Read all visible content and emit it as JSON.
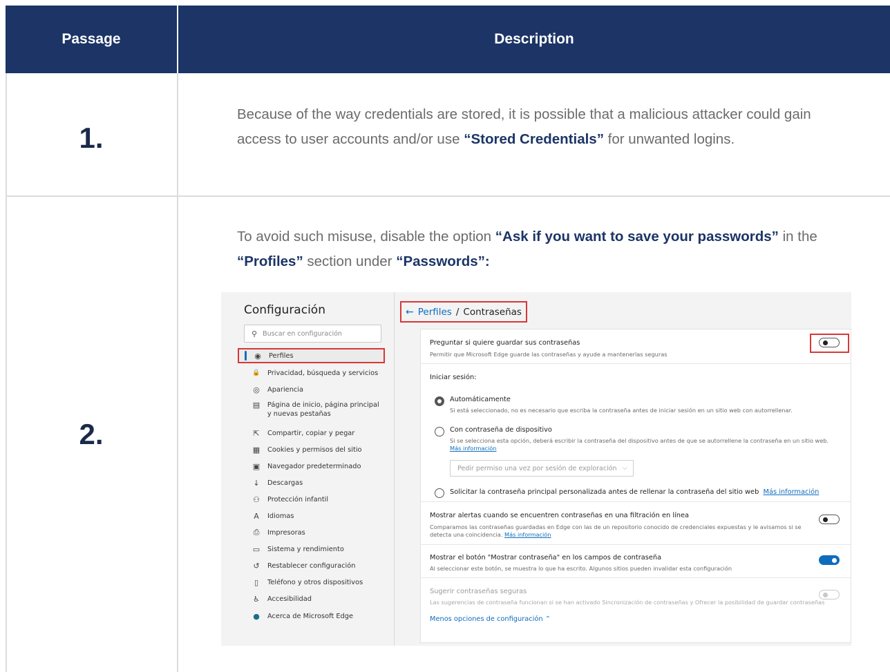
{
  "table": {
    "header_passage": "Passage",
    "header_description": "Description",
    "rows": [
      {
        "number": "1.",
        "text_a": "Because of the way credentials are stored, it is possible that a malicious attacker could gain access to user accounts and/or use ",
        "bold_a": "“Stored Credentials”",
        "text_b": " for unwanted logins."
      },
      {
        "number": "2.",
        "text_a": "To avoid such misuse, disable the option ",
        "bold_a": "“Ask if you want to save your passwords”",
        "text_b": " in the ",
        "bold_b": "“Profiles”",
        "text_c": " section under ",
        "bold_c": "“Passwords”:"
      }
    ]
  },
  "screenshot": {
    "sidebar": {
      "title": "Configuración",
      "search_placeholder": "Buscar en configuración",
      "items": [
        {
          "label": "Perfiles",
          "icon": "profile-icon",
          "glyph": "◉"
        },
        {
          "label": "Privacidad, búsqueda y servicios",
          "icon": "lock-icon",
          "glyph": "🔒"
        },
        {
          "label": "Apariencia",
          "icon": "palette-icon",
          "glyph": "◎"
        },
        {
          "label": "Página de inicio, página principal y nuevas pestañas",
          "icon": "home-page-icon",
          "glyph": "▤"
        },
        {
          "label": "Compartir, copiar y pegar",
          "icon": "share-icon",
          "glyph": "⇱"
        },
        {
          "label": "Cookies y permisos del sitio",
          "icon": "cookies-icon",
          "glyph": "▦"
        },
        {
          "label": "Navegador predeterminado",
          "icon": "browser-icon",
          "glyph": "▣"
        },
        {
          "label": "Descargas",
          "icon": "download-icon",
          "glyph": "↓"
        },
        {
          "label": "Protección infantil",
          "icon": "family-icon",
          "glyph": "⚇"
        },
        {
          "label": "Idiomas",
          "icon": "language-icon",
          "glyph": "A"
        },
        {
          "label": "Impresoras",
          "icon": "printer-icon",
          "glyph": "⎙"
        },
        {
          "label": "Sistema y rendimiento",
          "icon": "laptop-icon",
          "glyph": "▭"
        },
        {
          "label": "Restablecer configuración",
          "icon": "reset-icon",
          "glyph": "↺"
        },
        {
          "label": "Teléfono y otros dispositivos",
          "icon": "phone-icon",
          "glyph": "▯"
        },
        {
          "label": "Accesibilidad",
          "icon": "accessibility-icon",
          "glyph": "♿"
        },
        {
          "label": "Acerca de Microsoft Edge",
          "icon": "edge-icon",
          "glyph": "●"
        }
      ]
    },
    "breadcrumb": {
      "parent": "Perfiles",
      "separator": "/",
      "current": "Contraseñas"
    },
    "settings": {
      "offer_save": {
        "title": "Preguntar si quiere guardar sus contraseñas",
        "sub": "Permitir que Microsoft Edge guarde las contraseñas y ayude a mantenerlas seguras",
        "on": false
      },
      "signin_label": "Iniciar sesión:",
      "radio_auto": {
        "title": "Automáticamente",
        "sub": "Si está seleccionado, no es necesario que escriba la contraseña antes de iniciar sesión en un sitio web con autorrellenar.",
        "selected": true
      },
      "radio_device": {
        "title": "Con contraseña de dispositivo",
        "sub": "Si se selecciona esta opción, deberá escribir la contraseña del dispositivo antes de que se autorrellene la contraseña en un sitio web.",
        "link": "Más información",
        "select_value": "Pedir permiso una vez por sesión de exploración"
      },
      "radio_custom": {
        "title": "Solicitar la contraseña principal personalizada antes de rellenar la contraseña del sitio web",
        "link": "Más información"
      },
      "leak_alerts": {
        "title": "Mostrar alertas cuando se encuentren contraseñas en una filtración en línea",
        "sub": "Comparamos las contraseñas guardadas en Edge con las de un repositorio conocido de credenciales expuestas y le avisamos si se detecta una coincidencia.",
        "link": "Más información",
        "on": false
      },
      "reveal_button": {
        "title": "Mostrar el botón \"Mostrar contraseña\" en los campos de contraseña",
        "sub": "Al seleccionar este botón, se muestra lo que ha escrito. Algunos sitios pueden invalidar esta configuración",
        "on": true
      },
      "suggest_strong": {
        "title": "Sugerir contraseñas seguras",
        "sub": "Las sugerencias de contraseña funcionan si se han activado Sincronización de contraseñas y Ofrecer la posibilidad de guardar contraseñas",
        "on": false,
        "disabled": true
      },
      "fewer_options": "Menos opciones de configuración",
      "accent_color": "#0f6cbd",
      "highlight_color": "#d93636"
    }
  }
}
